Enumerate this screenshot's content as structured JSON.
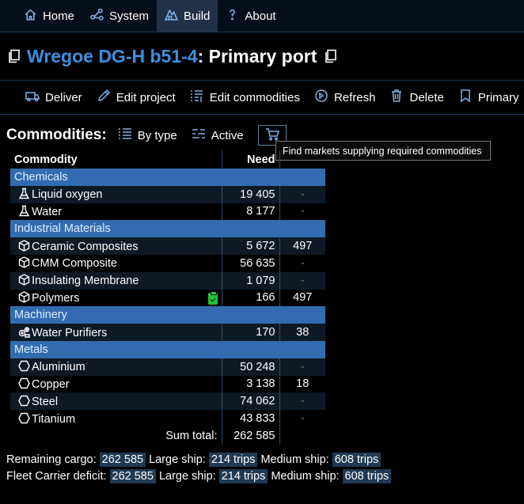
{
  "nav": [
    {
      "label": "Home",
      "icon": "home-icon"
    },
    {
      "label": "System",
      "icon": "network-icon"
    },
    {
      "label": "Build",
      "icon": "build-icon"
    },
    {
      "label": "About",
      "icon": "question-icon"
    }
  ],
  "title": {
    "link": "Wregoe DG-H b51-4",
    "rest": ": Primary port"
  },
  "toolbar": {
    "deliver": "Deliver",
    "edit_project": "Edit project",
    "edit_commodities": "Edit commodities",
    "refresh": "Refresh",
    "delete": "Delete",
    "primary": "Primary"
  },
  "commodities": {
    "title": "Commodities:",
    "by_type": "By type",
    "active": "Active",
    "tooltip": "Find markets supplying required commodities"
  },
  "table": {
    "headers": {
      "commodity": "Commodity",
      "need": "Need"
    },
    "groups": [
      {
        "label": "Chemicals",
        "rows": [
          {
            "name": "Liquid oxygen",
            "need": "19 405",
            "x": "-",
            "icon": "flask-icon"
          },
          {
            "name": "Water",
            "need": "8 177",
            "x": "-",
            "icon": "flask-icon"
          }
        ]
      },
      {
        "label": "Industrial Materials",
        "rows": [
          {
            "name": "Ceramic Composites",
            "need": "5 672",
            "x": "497",
            "icon": "cube-icon"
          },
          {
            "name": "CMM Composite",
            "need": "56 635",
            "x": "-",
            "icon": "cube-icon"
          },
          {
            "name": "Insulating Membrane",
            "need": "1 079",
            "x": "-",
            "icon": "cube-icon"
          },
          {
            "name": "Polymers",
            "need": "166",
            "x": "497",
            "icon": "cube-icon"
          }
        ]
      },
      {
        "label": "Machinery",
        "rows": [
          {
            "name": "Water Purifiers",
            "need": "170",
            "x": "38",
            "icon": "gears-icon"
          }
        ]
      },
      {
        "label": "Metals",
        "rows": [
          {
            "name": "Aluminium",
            "need": "50 248",
            "x": "-",
            "icon": "hexagon-icon"
          },
          {
            "name": "Copper",
            "need": "3 138",
            "x": "18",
            "icon": "hexagon-icon"
          },
          {
            "name": "Steel",
            "need": "74 062",
            "x": "-",
            "icon": "hexagon-icon"
          },
          {
            "name": "Titanium",
            "need": "43 833",
            "x": "-",
            "icon": "hexagon-icon"
          }
        ]
      }
    ],
    "sum_label": "Sum total:",
    "sum_value": "262 585"
  },
  "cargo": {
    "remaining_label": "Remaining cargo:",
    "remaining_value": "262 585",
    "large_label": "Large ship:",
    "large_value": "214 trips",
    "medium_label": "Medium ship:",
    "medium_value": "608 trips"
  },
  "deficit": {
    "label": "Fleet Carrier deficit:",
    "value": "262 585",
    "large_label": "Large ship:",
    "large_value": "214 trips",
    "medium_label": "Medium ship:",
    "medium_value": "608 trips"
  }
}
